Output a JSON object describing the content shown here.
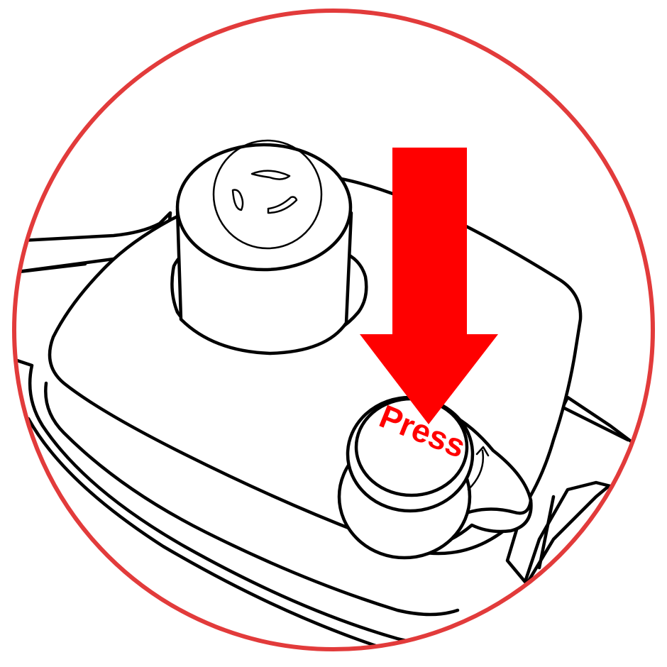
{
  "button": {
    "label": "Press"
  },
  "colors": {
    "circle_border": "#e23b3b",
    "arrow": "#ff0000",
    "label": "#ff0000",
    "line_art": "#000000",
    "background": "#ffffff"
  },
  "icons": {
    "frame": "circle-frame",
    "pointer": "down-arrow-icon",
    "release": "curved-arrow-icon"
  }
}
